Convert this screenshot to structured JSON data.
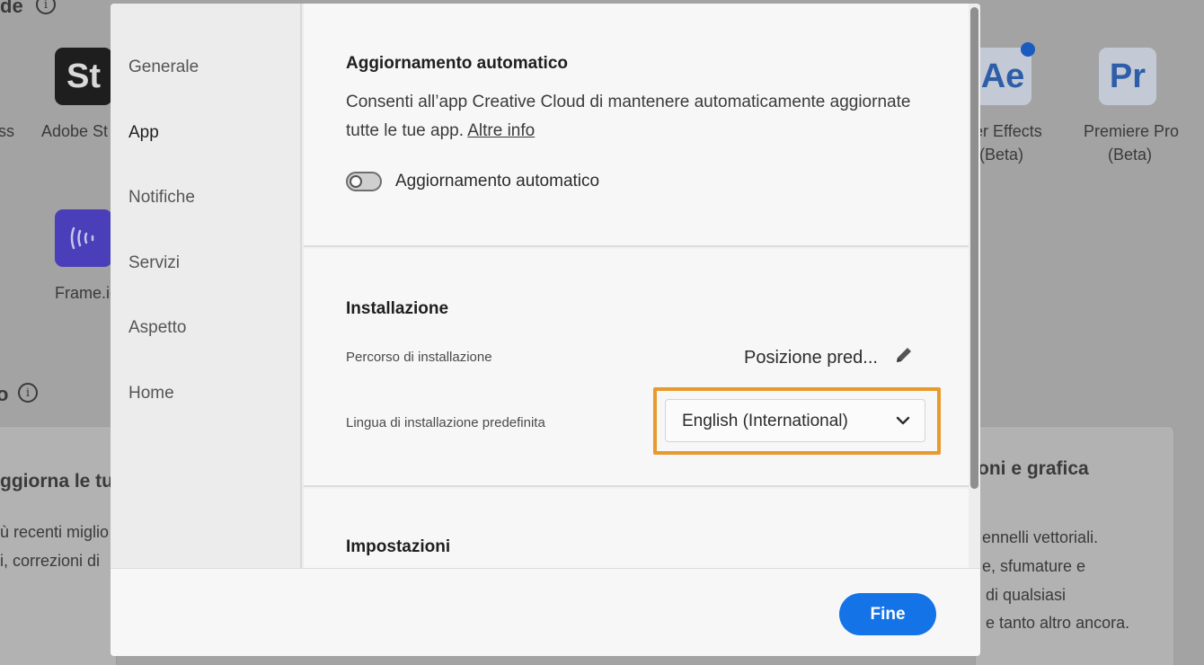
{
  "background": {
    "heading_fragment": "de",
    "section_fragment": "o",
    "apps": [
      {
        "tile": "St",
        "label": "Adobe St"
      },
      {
        "tile": "Ae",
        "label": "er Effects",
        "label2": "(Beta)"
      },
      {
        "tile": "Pr",
        "label": "Premiere Pro",
        "label2": "(Beta)"
      },
      {
        "label": "Frame.io"
      }
    ],
    "left_fragment": "ss",
    "card_left": {
      "title": "ggiorna le tu",
      "line1": "ù recenti miglio",
      "line2": "i, correzioni di"
    },
    "card_right": {
      "title": "oni e grafica",
      "line1": "ennelli vettoriali.",
      "line2": "e, sfumature e",
      "line3": "di qualsiasi",
      "line4": "e tanto altro ancora."
    },
    "colors": {
      "st_tile": "#1e1e1e",
      "ae_tile": "#c4c9d6",
      "frame_tile": "#4a3fb8"
    }
  },
  "sidebar": {
    "items": [
      {
        "label": "Generale",
        "active": false
      },
      {
        "label": "App",
        "active": true
      },
      {
        "label": "Notifiche",
        "active": false
      },
      {
        "label": "Servizi",
        "active": false
      },
      {
        "label": "Aspetto",
        "active": false
      },
      {
        "label": "Home",
        "active": false
      }
    ]
  },
  "auto_update": {
    "title": "Aggiornamento automatico",
    "description": "Consenti all’app Creative Cloud di mantenere automaticamente aggiornate tutte le tue app.",
    "link": "Altre info",
    "toggle_label": "Aggiornamento automatico",
    "toggle_on": false
  },
  "install": {
    "title": "Installazione",
    "path_label": "Percorso di installazione",
    "path_value": "Posizione pred...",
    "language_label": "Lingua di installazione predefinita",
    "language_value": "English (International)"
  },
  "settings": {
    "title": "Impostazioni"
  },
  "footer": {
    "done_label": "Fine"
  },
  "colors": {
    "primary": "#1473e6",
    "highlight": "#e89a2c"
  }
}
